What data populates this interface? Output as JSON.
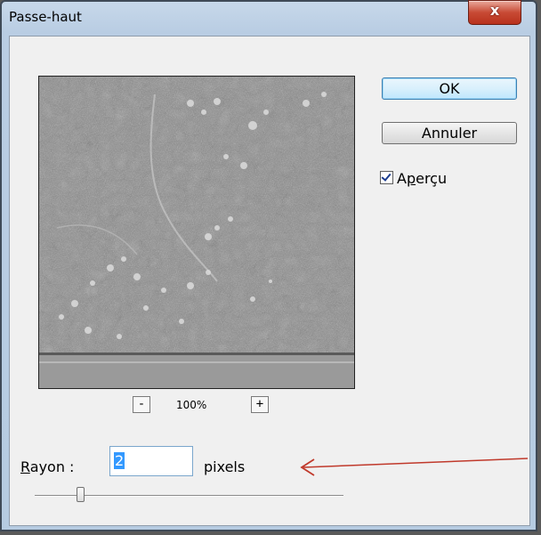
{
  "window": {
    "title": "Passe-haut",
    "close_symbol": "x"
  },
  "preview": {
    "zoom_minus": "-",
    "zoom_level": "100%",
    "zoom_plus": "+"
  },
  "buttons": {
    "ok": "OK",
    "cancel": "Annuler"
  },
  "preview_checkbox": {
    "label_pre": "A",
    "label_accel": "p",
    "label_post": "erçu",
    "checked": true
  },
  "radius": {
    "label_accel": "R",
    "label_rest": "ayon :",
    "value": "2",
    "unit": "pixels"
  },
  "colors": {
    "annotation_arrow": "#c0392b",
    "titlebar": "#b9cde3",
    "close_button": "#c84a35"
  }
}
